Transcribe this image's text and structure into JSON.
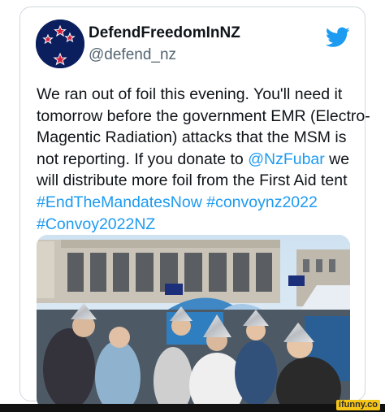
{
  "tweet": {
    "display_name": "DefendFreedomInNZ",
    "handle": "@defend_nz",
    "lines": [
      [
        {
          "t": "We ran out of foil this evening. You'll need it"
        }
      ],
      [
        {
          "t": "tomorrow before the government EMR (Electro-"
        }
      ],
      [
        {
          "t": "Magentic Radiation) attacks that the MSM is"
        }
      ],
      [
        {
          "t": "not reporting. If you donate to "
        },
        {
          "t": "@NzFubar",
          "link": true
        },
        {
          "t": " we"
        }
      ],
      [
        {
          "t": "will distribute more foil from the First Aid tent"
        }
      ],
      [
        {
          "t": "#EndTheMandatesNow",
          "link": true
        },
        {
          "t": " "
        },
        {
          "t": "#convoynz2022",
          "link": true
        }
      ],
      [
        {
          "t": "#Convoy2022NZ",
          "link": true
        }
      ]
    ]
  },
  "icons": {
    "avatar": "nz-flag-stars-avatar",
    "platform": "twitter-bird-icon",
    "photo": "protest-photo-foil-hats"
  },
  "colors": {
    "link": "#1d9bf0",
    "text": "#0f1419",
    "handle": "#536471",
    "avatar_bg": "#0b1f5e",
    "star_red": "#d4213d"
  },
  "watermark": "ifunny.co"
}
